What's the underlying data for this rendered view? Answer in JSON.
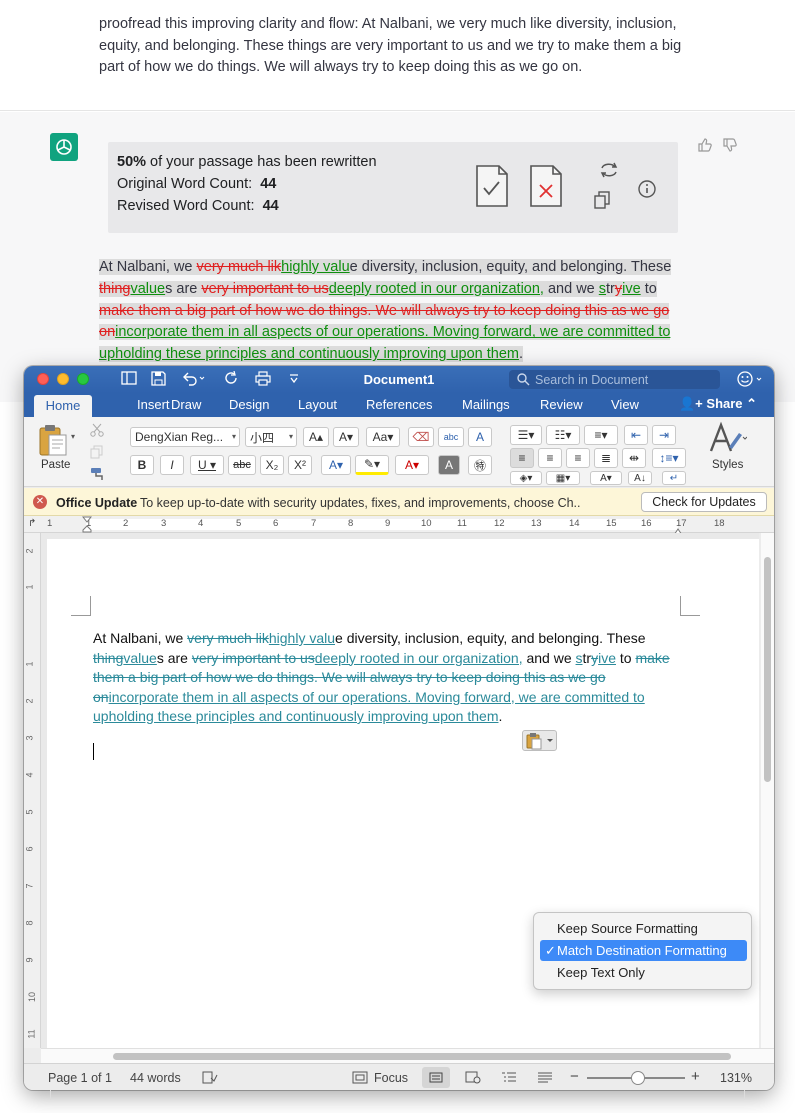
{
  "chat": {
    "user_message": "proofread this improving clarity and flow: At Nalbani, we very much like diversity, inclusion, equity, and belonging. These things are very important to us and we try to make them a big part of how we do things. We will always try to keep doing this as we go on.",
    "result": {
      "percent": "50%",
      "percent_suffix": " of your passage has been rewritten",
      "original_label": "Original Word Count:",
      "original_count": "44",
      "revised_label": "Revised Word Count:",
      "revised_count": "44"
    },
    "diff": [
      {
        "t": "plain",
        "s": "At Nalbani, we "
      },
      {
        "t": "del",
        "s": "very much lik"
      },
      {
        "t": "ins",
        "s": "highly valu"
      },
      {
        "t": "plain",
        "s": "e diversity, inclusion, equity, and belonging. These "
      },
      {
        "t": "del",
        "s": "thing"
      },
      {
        "t": "ins",
        "s": "value"
      },
      {
        "t": "plain",
        "s": "s are "
      },
      {
        "t": "del",
        "s": "very important to us"
      },
      {
        "t": "ins",
        "s": "deeply rooted in our organization,"
      },
      {
        "t": "plain",
        "s": " and we "
      },
      {
        "t": "ins",
        "s": "s"
      },
      {
        "t": "plain",
        "s": "tr"
      },
      {
        "t": "del",
        "s": "y"
      },
      {
        "t": "ins",
        "s": "ive"
      },
      {
        "t": "plain",
        "s": " to "
      },
      {
        "t": "del",
        "s": "make them a big part of how we do things. We will always try to keep doing this as we go on"
      },
      {
        "t": "ins",
        "s": "incorporate them in all aspects of our operations. Moving forward, we are committed to upholding these principles and continuously improving upon them"
      },
      {
        "t": "plain",
        "s": "."
      }
    ]
  },
  "word": {
    "title": "Document1",
    "search_placeholder": "Search in Document",
    "tabs": [
      "Home",
      "Insert",
      "Draw",
      "Design",
      "Layout",
      "References",
      "Mailings",
      "Review",
      "View"
    ],
    "share_label": "Share",
    "font_name": "DengXian Reg...",
    "font_size": "小四",
    "paste_label": "Paste",
    "styles_label": "Styles",
    "update": {
      "title": "Office Update",
      "message": "To keep up-to-date with security updates, fixes, and improvements, choose Ch...",
      "button": "Check for Updates"
    },
    "ruler_h": [
      "1",
      "1",
      "2",
      "3",
      "4",
      "5",
      "6",
      "7",
      "8",
      "9",
      "10",
      "11",
      "12",
      "13",
      "14",
      "15",
      "16",
      "17",
      "18"
    ],
    "ruler_v": [
      "2",
      "1",
      "1",
      "2",
      "3",
      "4",
      "5",
      "6",
      "7",
      "8",
      "9",
      "10",
      "11"
    ],
    "paste_menu": {
      "items": [
        "Keep Source Formatting",
        "Match Destination Formatting",
        "Keep Text Only"
      ],
      "selected_index": 1
    },
    "status": {
      "page": "Page 1 of 1",
      "words": "44 words",
      "focus": "Focus",
      "zoom": "131%",
      "zoom_level_percent": 131
    },
    "colors": {
      "titlebar": "#2f62ad",
      "deleted_chat": "#e02020",
      "inserted_chat": "#0f8f0f",
      "track_changes": "#2b8a9a",
      "menu_selection": "#3d8af7"
    }
  }
}
